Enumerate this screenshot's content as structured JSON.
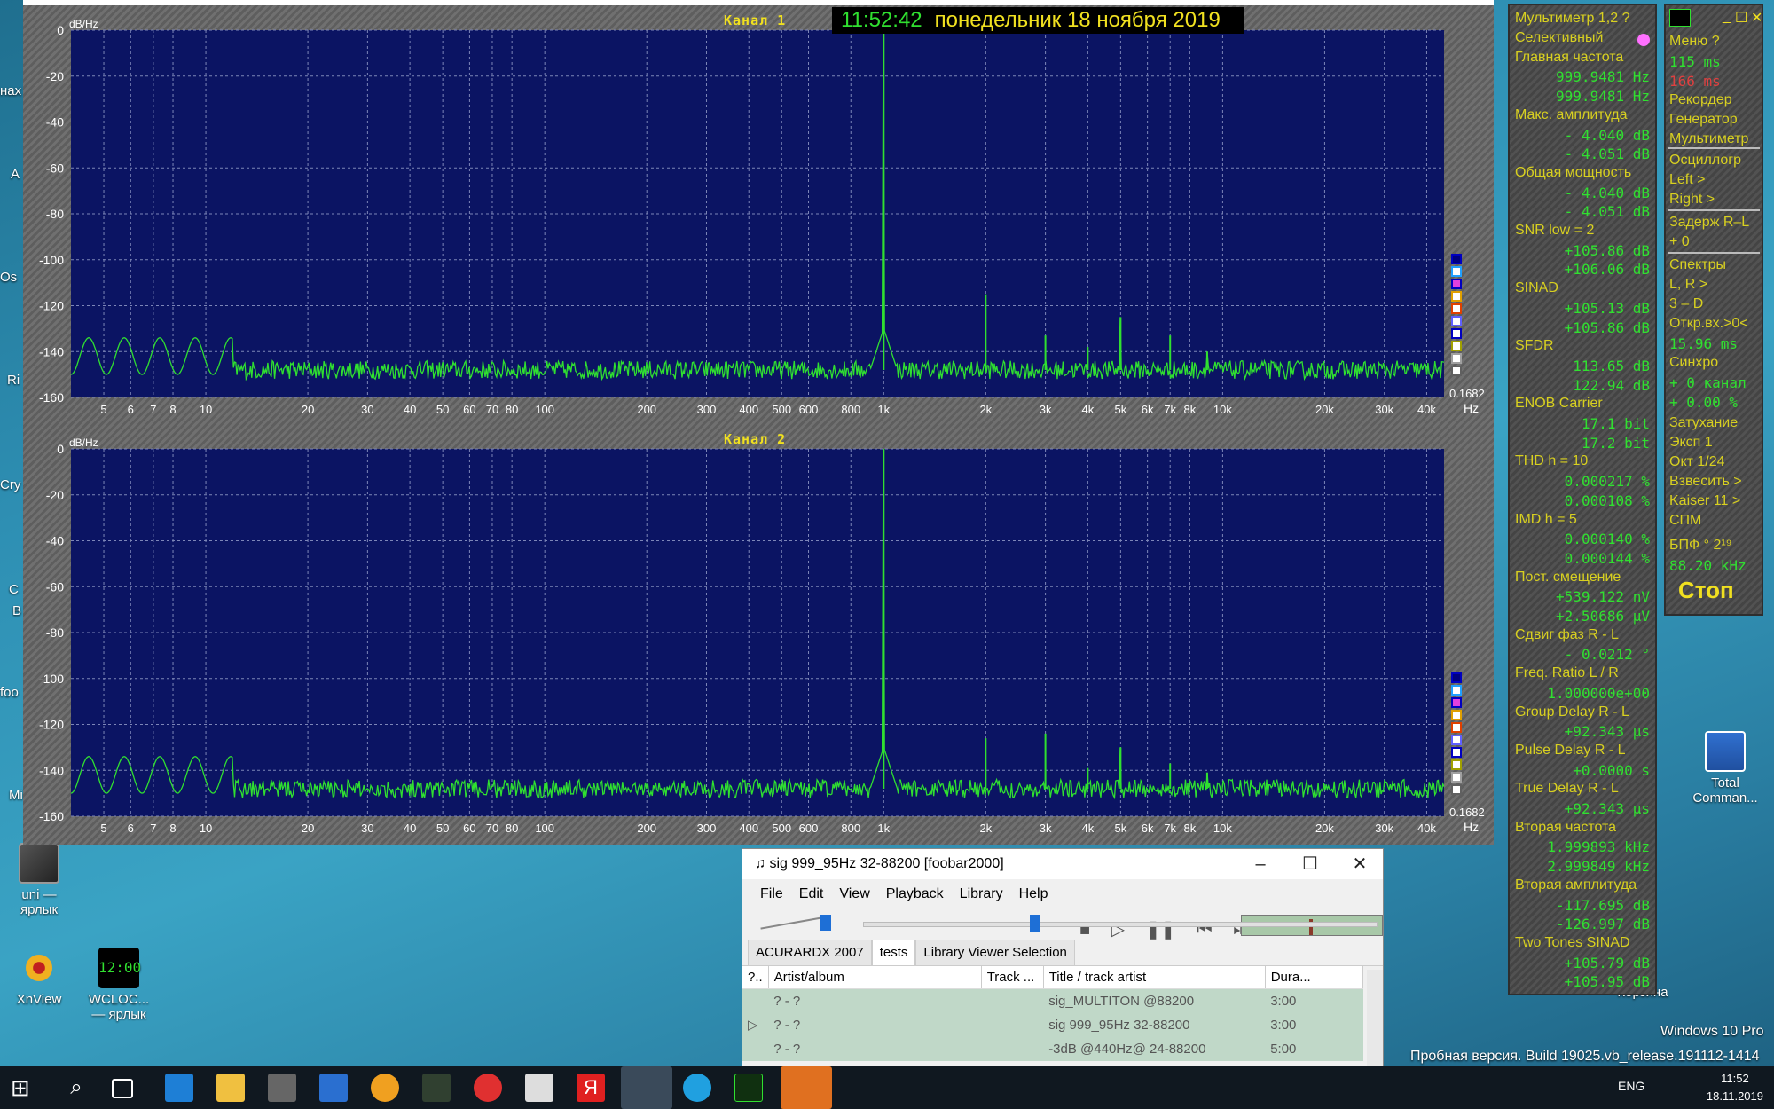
{
  "desktop": {
    "edge_labels": [
      "нах",
      "A",
      "Os",
      "Ri",
      "Cry",
      "C",
      "B",
      "foo",
      "Mi"
    ],
    "icons": [
      {
        "label": "uni —\nярлык"
      },
      {
        "label": "XnView"
      },
      {
        "label": "WCLOC...\n— ярлык"
      },
      {
        "label": "Total\nComman..."
      },
      {
        "label": "Корзина"
      }
    ],
    "watermark_line1": "Windows 10 Pro",
    "watermark_line2": "Пробная версия. Build 19025.vb_release.191112-1414"
  },
  "clock": {
    "time": "11:52:42",
    "date": "понедельник 18 ноября 2019"
  },
  "analyzer": {
    "unit": "dB/Hz",
    "corner_value": "0.1682",
    "hz_label": "Hz",
    "panels": [
      {
        "title": "Канал 1"
      },
      {
        "title": "Канал 2"
      }
    ]
  },
  "chart_data": [
    {
      "type": "line",
      "title": "Канал 1",
      "ylabel": "dB/Hz",
      "xlabel": "Hz",
      "x_scale": "log",
      "xlim": [
        4,
        45000
      ],
      "ylim": [
        -160,
        0
      ],
      "y_ticks": [
        0,
        -20,
        -40,
        -60,
        -80,
        -100,
        -120,
        -140,
        -160
      ],
      "x_ticks": [
        "5",
        "6",
        "7",
        "8",
        "10",
        "20",
        "30",
        "40",
        "50",
        "60",
        "70",
        "80",
        "100",
        "200",
        "300",
        "400",
        "500",
        "600",
        "800",
        "1k",
        "2k",
        "3k",
        "4k",
        "5k",
        "6k",
        "7k",
        "8k",
        "10k",
        "20k",
        "30k",
        "40k"
      ],
      "grid": true,
      "series": [
        {
          "color": "#30e030",
          "peaks": [
            {
              "x": 1000,
              "y": 4
            },
            {
              "x": 2000,
              "y": -115
            },
            {
              "x": 3000,
              "y": -133
            },
            {
              "x": 4000,
              "y": -138
            },
            {
              "x": 5000,
              "y": -125
            },
            {
              "x": 7000,
              "y": -133
            },
            {
              "x": 9000,
              "y": -140
            }
          ],
          "noise_floor": -148
        }
      ]
    },
    {
      "type": "line",
      "title": "Канал 2",
      "ylabel": "dB/Hz",
      "xlabel": "Hz",
      "x_scale": "log",
      "xlim": [
        4,
        45000
      ],
      "ylim": [
        -160,
        0
      ],
      "y_ticks": [
        0,
        -20,
        -40,
        -60,
        -80,
        -100,
        -120,
        -140,
        -160
      ],
      "x_ticks": [
        "5",
        "6",
        "7",
        "8",
        "10",
        "20",
        "30",
        "40",
        "50",
        "60",
        "70",
        "80",
        "100",
        "200",
        "300",
        "400",
        "500",
        "600",
        "800",
        "1k",
        "2k",
        "3k",
        "4k",
        "5k",
        "6k",
        "7k",
        "8k",
        "10k",
        "20k",
        "30k",
        "40k"
      ],
      "grid": true,
      "series": [
        {
          "color": "#30e030",
          "peaks": [
            {
              "x": 1000,
              "y": 4
            },
            {
              "x": 2000,
              "y": -126
            },
            {
              "x": 3000,
              "y": -124
            },
            {
              "x": 4000,
              "y": -139
            },
            {
              "x": 5000,
              "y": -130
            },
            {
              "x": 7000,
              "y": -137
            },
            {
              "x": 9000,
              "y": -141
            }
          ],
          "noise_floor": -148
        }
      ]
    }
  ],
  "meter": {
    "title": "Мультиметр 1,2  ?",
    "rows": [
      {
        "text": "Селективный",
        "kind": "lbl"
      },
      {
        "text": "Главная частота",
        "kind": "lbl"
      },
      {
        "text": "999.9481  Hz",
        "kind": "val"
      },
      {
        "text": "999.9481  Hz",
        "kind": "val"
      },
      {
        "text": "Макс. амплитуда",
        "kind": "lbl"
      },
      {
        "text": "-    4.040 dB",
        "kind": "val"
      },
      {
        "text": "-    4.051 dB",
        "kind": "val"
      },
      {
        "text": "Общая мощность",
        "kind": "lbl"
      },
      {
        "text": "-    4.040 dB",
        "kind": "val"
      },
      {
        "text": "-    4.051 dB",
        "kind": "val"
      },
      {
        "text": "SNR      low =    2",
        "kind": "lbl"
      },
      {
        "text": "+105.86 dB",
        "kind": "val"
      },
      {
        "text": "+106.06 dB",
        "kind": "val"
      },
      {
        "text": "SINAD",
        "kind": "lbl"
      },
      {
        "text": "+105.13 dB",
        "kind": "val"
      },
      {
        "text": "+105.86 dB",
        "kind": "val"
      },
      {
        "text": "SFDR",
        "kind": "lbl"
      },
      {
        "text": "113.65 dB",
        "kind": "val"
      },
      {
        "text": "122.94 dB",
        "kind": "val"
      },
      {
        "text": "ENOB  Carrier",
        "kind": "lbl"
      },
      {
        "text": "17.1 bit",
        "kind": "val"
      },
      {
        "text": "17.2 bit",
        "kind": "val"
      },
      {
        "text": "THD      h =   10",
        "kind": "lbl"
      },
      {
        "text": "0.000217 %",
        "kind": "val"
      },
      {
        "text": "0.000108 %",
        "kind": "val"
      },
      {
        "text": "IMD       h =    5",
        "kind": "lbl"
      },
      {
        "text": "0.000140 %",
        "kind": "val"
      },
      {
        "text": "0.000144 %",
        "kind": "val"
      },
      {
        "text": "Пост. смещение",
        "kind": "lbl"
      },
      {
        "text": "+539.122 nV",
        "kind": "val"
      },
      {
        "text": "+2.50686 µV",
        "kind": "val"
      },
      {
        "text": "Сдвиг фаз R - L",
        "kind": "lbl"
      },
      {
        "text": "-   0.0212 °",
        "kind": "val"
      },
      {
        "text": "Freq. Ratio  L / R",
        "kind": "lbl"
      },
      {
        "text": "1.000000e+00",
        "kind": "val"
      },
      {
        "text": "Group Delay R - L",
        "kind": "lbl"
      },
      {
        "text": "+92.343 µs",
        "kind": "val"
      },
      {
        "text": "Pulse Delay R - L",
        "kind": "lbl"
      },
      {
        "text": "+0.0000  s",
        "kind": "val"
      },
      {
        "text": "True Delay R - L",
        "kind": "lbl"
      },
      {
        "text": "+92.343 µs",
        "kind": "val"
      },
      {
        "text": "Вторая частота",
        "kind": "lbl"
      },
      {
        "text": "1.999893 kHz",
        "kind": "val"
      },
      {
        "text": "2.999849 kHz",
        "kind": "val"
      },
      {
        "text": "Вторая амплитуда",
        "kind": "lbl"
      },
      {
        "text": "-117.695 dB",
        "kind": "val"
      },
      {
        "text": "-126.997 dB",
        "kind": "val"
      },
      {
        "text": "Two Tones SINAD",
        "kind": "lbl"
      },
      {
        "text": "+105.79 dB",
        "kind": "val"
      },
      {
        "text": "+105.95 dB",
        "kind": "val"
      }
    ]
  },
  "ctrl": {
    "items": [
      {
        "text": "Меню        ?",
        "cls": ""
      },
      {
        "text": "115  ms",
        "cls": "g"
      },
      {
        "text": "166  ms",
        "cls": "r"
      },
      {
        "text": "Рекордер",
        "cls": ""
      },
      {
        "text": "Генератор",
        "cls": ""
      },
      {
        "text": "Мультиметр",
        "cls": ""
      },
      {
        "text": "Осциллогр",
        "cls": ""
      },
      {
        "text": "Left      >",
        "cls": ""
      },
      {
        "text": "Right     >",
        "cls": ""
      },
      {
        "text": "Задерж R–L",
        "cls": ""
      },
      {
        "text": "+        0",
        "cls": ""
      },
      {
        "text": "Спектры",
        "cls": ""
      },
      {
        "text": "L, R      >",
        "cls": ""
      },
      {
        "text": "3 – D",
        "cls": ""
      },
      {
        "text": "Откр.вх.>0<",
        "cls": ""
      },
      {
        "text": "15.96 ms",
        "cls": "g"
      },
      {
        "text": "Синхро",
        "cls": ""
      },
      {
        "text": "+ 0 канал",
        "cls": "g"
      },
      {
        "text": "+ 0.00 %",
        "cls": "g"
      },
      {
        "text": "Затухание",
        "cls": ""
      },
      {
        "text": "Эксп      1",
        "cls": ""
      },
      {
        "text": "Окт  1/24",
        "cls": ""
      },
      {
        "text": "Взвесить  >",
        "cls": ""
      },
      {
        "text": "Kaiser 11  >",
        "cls": ""
      },
      {
        "text": "СПМ",
        "cls": ""
      },
      {
        "text": "БПФ ° 2¹⁹",
        "cls": ""
      },
      {
        "text": "88.20 kHz",
        "cls": "g"
      }
    ],
    "stop": "Стоп"
  },
  "foobar": {
    "title": "sig 999_95Hz 32-88200  [foobar2000]",
    "menu": [
      "File",
      "Edit",
      "View",
      "Playback",
      "Library",
      "Help"
    ],
    "tabs": [
      "ACURARDX 2007",
      "tests",
      "Library Viewer Selection"
    ],
    "columns": [
      "?..",
      "Artist/album",
      "Track ...",
      "Title / track artist",
      "Dura..."
    ],
    "rows": [
      {
        "artist": "? - ?",
        "title": "sig_MULTITON @88200",
        "duration": "3:00"
      },
      {
        "artist": "? - ?",
        "title": "sig 999_95Hz 32-88200",
        "duration": "3:00"
      },
      {
        "artist": "? - ?",
        "title": "-3dB @440Hz@ 24-88200",
        "duration": "5:00"
      }
    ]
  },
  "taskbar": {
    "lang": "ENG",
    "time": "11:52",
    "date": "18.11.2019"
  }
}
